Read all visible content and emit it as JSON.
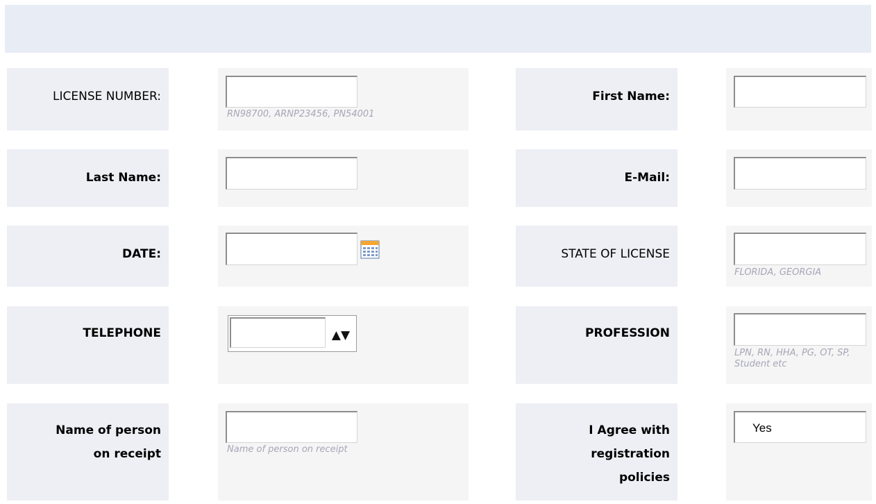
{
  "form": {
    "license_number": {
      "label": "LICENSE NUMBER:",
      "value": "",
      "hint": "RN98700, ARNP23456, PN54001"
    },
    "first_name": {
      "label": "First Name:",
      "value": ""
    },
    "last_name": {
      "label": "Last Name:",
      "value": ""
    },
    "email": {
      "label": "E-Mail:",
      "value": ""
    },
    "date": {
      "label": "DATE:",
      "value": ""
    },
    "state_of_license": {
      "label": "STATE OF LICENSE",
      "value": "",
      "hint": "FLORIDA, GEORGIA"
    },
    "telephone": {
      "label": "TELEPHONE",
      "value": "",
      "arrows": "▲▼"
    },
    "profession": {
      "label": "PROFESSION",
      "value": "",
      "hint": "LPN, RN, HHA, PG, OT, SP, Student etc"
    },
    "receipt_name": {
      "label_line1": "Name of person",
      "label_line2": "on receipt",
      "value": "",
      "hint": "Name of person on receipt"
    },
    "agree": {
      "label_line1": "I Agree with",
      "label_line2": "registration",
      "label_line3": "policies",
      "value": "Yes"
    }
  },
  "icons": {
    "date_picker": "calendar-icon"
  }
}
